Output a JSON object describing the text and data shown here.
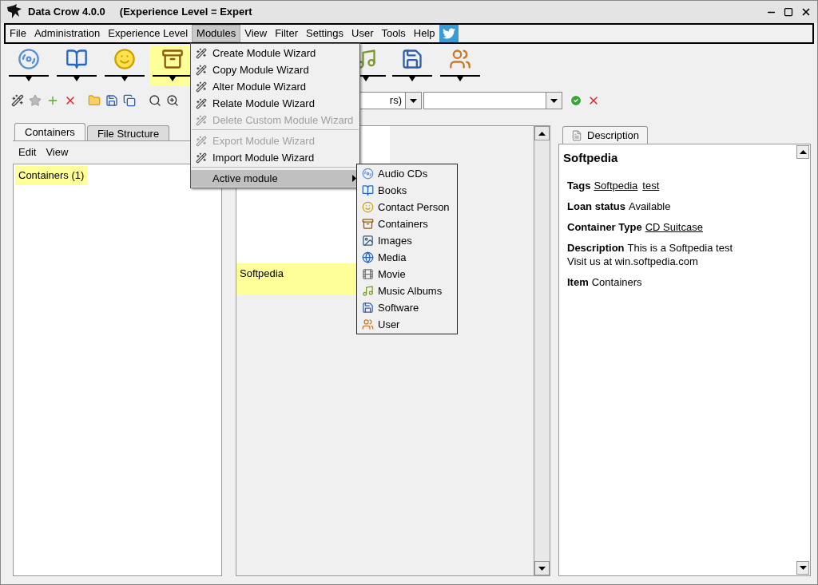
{
  "window": {
    "title": "Data Crow 4.0.0",
    "subtitle": "(Experience Level = Expert"
  },
  "menu_bar": [
    {
      "label": "File",
      "selected": false
    },
    {
      "label": "Administration",
      "selected": false
    },
    {
      "label": "Experience Level",
      "selected": false
    },
    {
      "label": "Modules",
      "selected": true
    },
    {
      "label": "View",
      "selected": false
    },
    {
      "label": "Filter",
      "selected": false
    },
    {
      "label": "Settings",
      "selected": false
    },
    {
      "label": "User",
      "selected": false
    },
    {
      "label": "Tools",
      "selected": false
    },
    {
      "label": "Help",
      "selected": false
    }
  ],
  "module_buttons": [
    {
      "selected": false
    },
    {
      "selected": false
    },
    {
      "selected": false
    },
    {
      "selected": true
    },
    {
      "selected": false
    },
    {
      "selected": false
    },
    {
      "selected": false
    }
  ],
  "filter": {
    "combo_value": "rs)"
  },
  "left_panel": {
    "tabs": [
      {
        "label": "Containers",
        "selected": true
      },
      {
        "label": "File Structure",
        "selected": false
      }
    ],
    "menu": [
      "Edit",
      "View"
    ],
    "tree": [
      {
        "label": "Containers (1)",
        "selected": true
      }
    ]
  },
  "items": [
    {
      "label": "Softpedia",
      "selected": true
    }
  ],
  "details": {
    "tab": {
      "label": "Description",
      "selected": true
    },
    "title": "Softpedia",
    "fields": [
      {
        "label": "Tags",
        "values": [
          {
            "text": "Softpedia",
            "link": true
          },
          {
            "text": "test",
            "link": true
          }
        ]
      },
      {
        "label": "Loan status",
        "values": [
          {
            "text": "Available",
            "link": false
          }
        ]
      },
      {
        "label": "Container Type",
        "values": [
          {
            "text": "CD Suitcase",
            "link": true
          }
        ]
      },
      {
        "label": "Description",
        "values": [
          {
            "text": "This is a Softpedia test",
            "link": false
          }
        ],
        "extra_lines": [
          "Visit us at win.softpedia.com"
        ]
      },
      {
        "label": "Item",
        "values": [
          {
            "text": "Containers",
            "link": false
          }
        ]
      }
    ]
  },
  "modules_menu": [
    {
      "kind": "item",
      "label": "Create Module Wizard",
      "disabled": false,
      "selected": false
    },
    {
      "kind": "item",
      "label": "Copy Module Wizard",
      "disabled": false,
      "selected": false
    },
    {
      "kind": "item",
      "label": "Alter Module Wizard",
      "disabled": false,
      "selected": false
    },
    {
      "kind": "item",
      "label": "Relate Module Wizard",
      "disabled": false,
      "selected": false
    },
    {
      "kind": "item",
      "label": "Delete Custom Module Wizard",
      "disabled": true,
      "selected": false
    },
    {
      "kind": "separator"
    },
    {
      "kind": "item",
      "label": "Export Module Wizard",
      "disabled": true,
      "selected": false
    },
    {
      "kind": "item",
      "label": "Import Module Wizard",
      "disabled": false,
      "selected": false
    },
    {
      "kind": "separator"
    },
    {
      "kind": "submenu",
      "label": "Active module",
      "disabled": false,
      "selected": true
    }
  ],
  "active_module_menu": [
    {
      "label": "Audio CDs"
    },
    {
      "label": "Books"
    },
    {
      "label": "Contact Person"
    },
    {
      "label": "Containers"
    },
    {
      "label": "Images"
    },
    {
      "label": "Media"
    },
    {
      "label": "Movie"
    },
    {
      "label": "Music Albums"
    },
    {
      "label": "Software"
    },
    {
      "label": "User"
    }
  ]
}
